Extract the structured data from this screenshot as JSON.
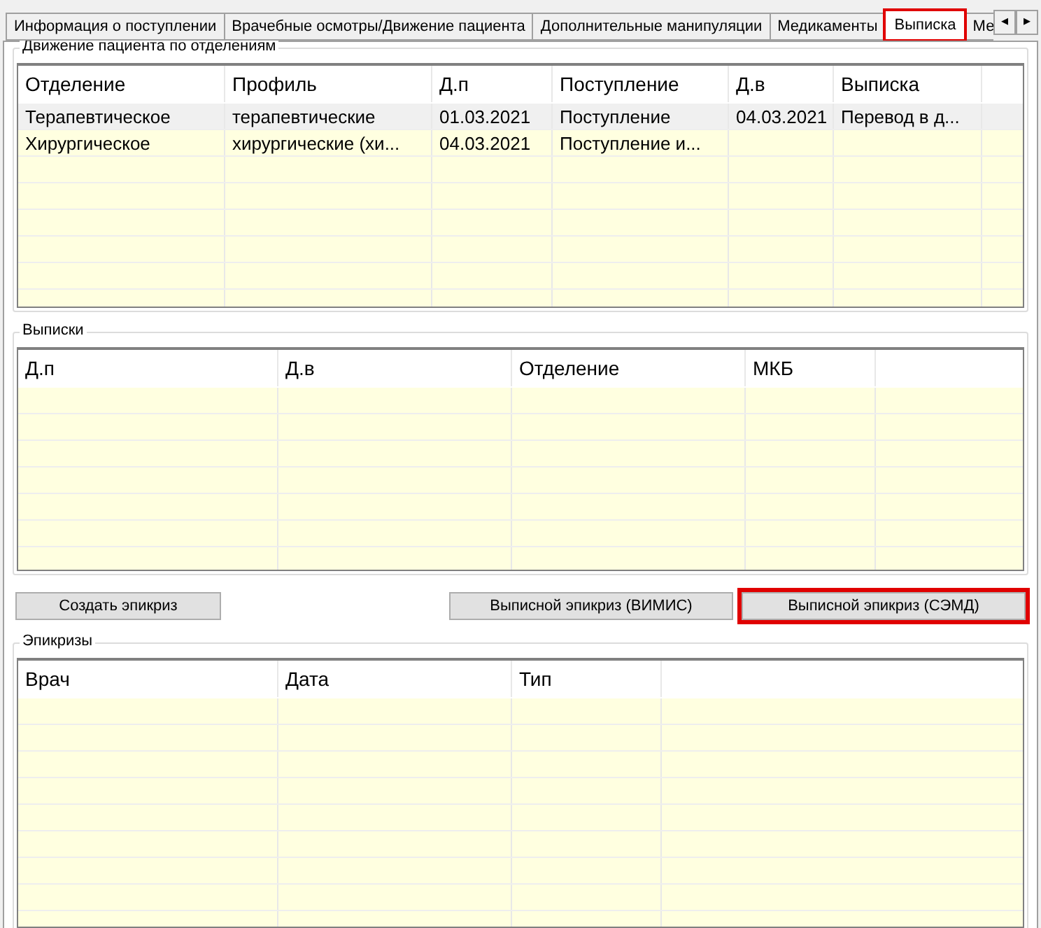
{
  "tabs": [
    {
      "label": "Информация о поступлении",
      "selected": false,
      "highlighted": false
    },
    {
      "label": "Врачебные осмотры/Движение пациента",
      "selected": false,
      "highlighted": false
    },
    {
      "label": "Дополнительные манипуляции",
      "selected": false,
      "highlighted": false
    },
    {
      "label": "Медикаменты",
      "selected": false,
      "highlighted": false
    },
    {
      "label": "Выписка",
      "selected": true,
      "highlighted": true
    },
    {
      "label": "Ме",
      "selected": false,
      "highlighted": false
    }
  ],
  "tab_scroll": {
    "left": "◂",
    "right": "▸"
  },
  "movement": {
    "title": "Движение пациента по отделениям",
    "columns": [
      "Отделение",
      "Профиль",
      "Д.п",
      "Поступление",
      "Д.в",
      "Выписка"
    ],
    "rows": [
      {
        "cells": [
          "Терапевтическое",
          "терапевтические",
          "01.03.2021",
          "Поступление",
          "04.03.2021",
          "Перевод в д..."
        ],
        "selected": true
      },
      {
        "cells": [
          "Хирургическое",
          "хирургические (хи...",
          "04.03.2021",
          "Поступление и...",
          "",
          ""
        ],
        "selected": false
      }
    ]
  },
  "discharges": {
    "title": "Выписки",
    "columns": [
      "Д.п",
      "Д.в",
      "Отделение",
      "МКБ"
    ]
  },
  "buttons": [
    {
      "label": "Создать эпикриз",
      "highlighted": false
    },
    {
      "label": "Выписной эпикриз (ВИМИС)",
      "highlighted": false
    },
    {
      "label": "Выписной эпикриз (СЭМД)",
      "highlighted": true
    }
  ],
  "epicrises": {
    "title": "Эпикризы",
    "columns": [
      "Врач",
      "Дата",
      "Тип"
    ]
  }
}
